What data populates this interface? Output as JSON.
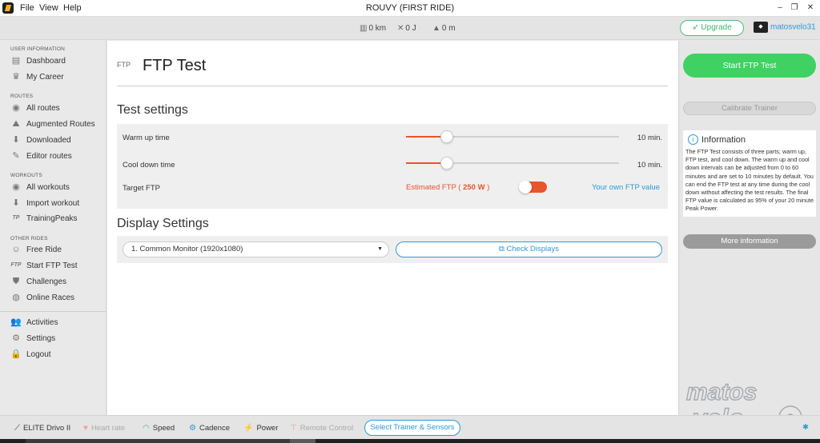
{
  "window": {
    "title": "ROUVY (FIRST RIDE)",
    "menu": [
      "File",
      "View",
      "Help"
    ]
  },
  "topbar": {
    "distance": "0 km",
    "energy": "0 J",
    "elevation": "0 m",
    "upgrade_label": "Upgrade",
    "username": "matosvelo31"
  },
  "sidebar": {
    "sections": {
      "user_information": "USER INFORMATION",
      "routes": "ROUTES",
      "workouts": "WORKOUTS",
      "other_rides": "OTHER RIDES"
    },
    "items": {
      "dashboard": "Dashboard",
      "my_career": "My Career",
      "all_routes": "All routes",
      "augmented_routes": "Augmented Routes",
      "downloaded": "Downloaded",
      "editor_routes": "Editor routes",
      "all_workouts": "All workouts",
      "import_workout": "Import workout",
      "trainingpeaks": "TrainingPeaks",
      "free_ride": "Free Ride",
      "start_ftp_test": "Start FTP Test",
      "challenges": "Challenges",
      "online_races": "Online Races",
      "activities": "Activities",
      "settings": "Settings",
      "logout": "Logout"
    },
    "ftp_icon_text": "FTP",
    "tp_icon_text": "TP"
  },
  "main": {
    "tag": "FTP",
    "title": "FTP Test",
    "test_settings": {
      "heading": "Test settings",
      "warmup_label": "Warm up time",
      "warmup_value": "10 min.",
      "warmup_level": 0.19,
      "cooldown_label": "Cool down time",
      "cooldown_value": "10 min.",
      "cooldown_level": 0.19,
      "target_label": "Target FTP",
      "estimated_prefix": "Estimated FTP (",
      "estimated_value": "250 W",
      "estimated_suffix": ")",
      "own_value_label": "Your own FTP value"
    },
    "display_settings": {
      "heading": "Display Settings",
      "monitor_selected": "1. Common Monitor (1920x1080)",
      "check_label": "Check Displays"
    }
  },
  "right_panel": {
    "start_label": "Start FTP Test",
    "calibrate_label": "Calibrate Trainer",
    "info_title": "Information",
    "info_text": "The FTP Test consists of three parts; warm up, FTP test, and cool down. The warm up and cool down intervals can be adjusted from 0 to 60 minutes and are set to 10 minutes by default. You can end the FTP test at any time during the cool down without affecting the test results. The final FTP value is calculated as 95% of your 20 minute Peak Power.",
    "more_label": "More information"
  },
  "bottombar": {
    "trainer": "ELITE Drivo II",
    "heart_rate": "Heart rate",
    "speed": "Speed",
    "cadence": "Cadence",
    "power": "Power",
    "remote_control": "Remote Control",
    "select_trainer": "Select Trainer & Sensors"
  },
  "watermark_text": "matos velo",
  "colors": {
    "accent_orange": "#e8542d",
    "accent_blue": "#2b9ad6",
    "accent_green": "#3fd162"
  }
}
